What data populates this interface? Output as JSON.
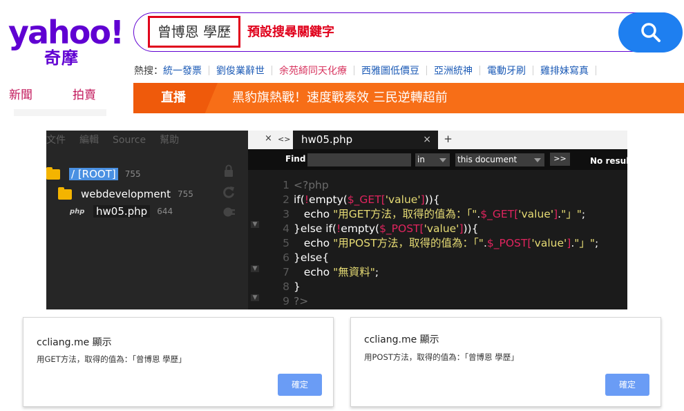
{
  "yahoo": {
    "brand": "yahoo!",
    "brand_sub": "奇摩",
    "search_value": "曾博恩 學歷",
    "search_hint": "預設搜尋關鍵字",
    "trending_label": "熱搜：",
    "trending_items": [
      "統一發票",
      "劉俊業辭世",
      "余苑綺同天化療",
      "西雅圖低價豆",
      "亞洲統神",
      "電動牙刷",
      "雞排妹寫真"
    ],
    "nav_tabs": [
      "新聞",
      "拍賣"
    ],
    "live_tag": "直播",
    "live_headline": "黑豹旗熱戰！速度戰奏效 三民逆轉超前",
    "colors": {
      "brand": "#6001d2",
      "search_button": "#1e7ff0",
      "live_bar": "#f76e17",
      "highlight_box": "#e0001b"
    }
  },
  "editor": {
    "menu": [
      "文件",
      "編輯",
      "Source",
      "幫助"
    ],
    "tree": [
      {
        "name": "/ [ROOT]",
        "perm": "755"
      },
      {
        "name": "webdevelopment",
        "perm": "755"
      },
      {
        "name": "hw05.php",
        "perm": "644",
        "badge": "php"
      }
    ],
    "tab_controls": [
      "×",
      "<>"
    ],
    "active_tab": "hw05.php",
    "tab_close": "×",
    "tab_add": "+",
    "find_label": "Find",
    "find_value": "",
    "scope_option": "in",
    "target_option": "this document",
    "find_next": ">>",
    "find_status": "No results",
    "fold_arrows": [
      "▼",
      "▼",
      "▼"
    ],
    "line_numbers": [
      "1",
      "2",
      "3",
      "4",
      "5",
      "6",
      "7",
      "8",
      "9"
    ]
  },
  "dialogs": [
    {
      "title": "ccliang.me 顯示",
      "message": "用GET方法，取得的值為：「曾博恩 學歷」",
      "ok": "確定"
    },
    {
      "title": "ccliang.me 顯示",
      "message": "用POST方法，取得的值為：「曾博恩 學歷」",
      "ok": "確定"
    }
  ]
}
